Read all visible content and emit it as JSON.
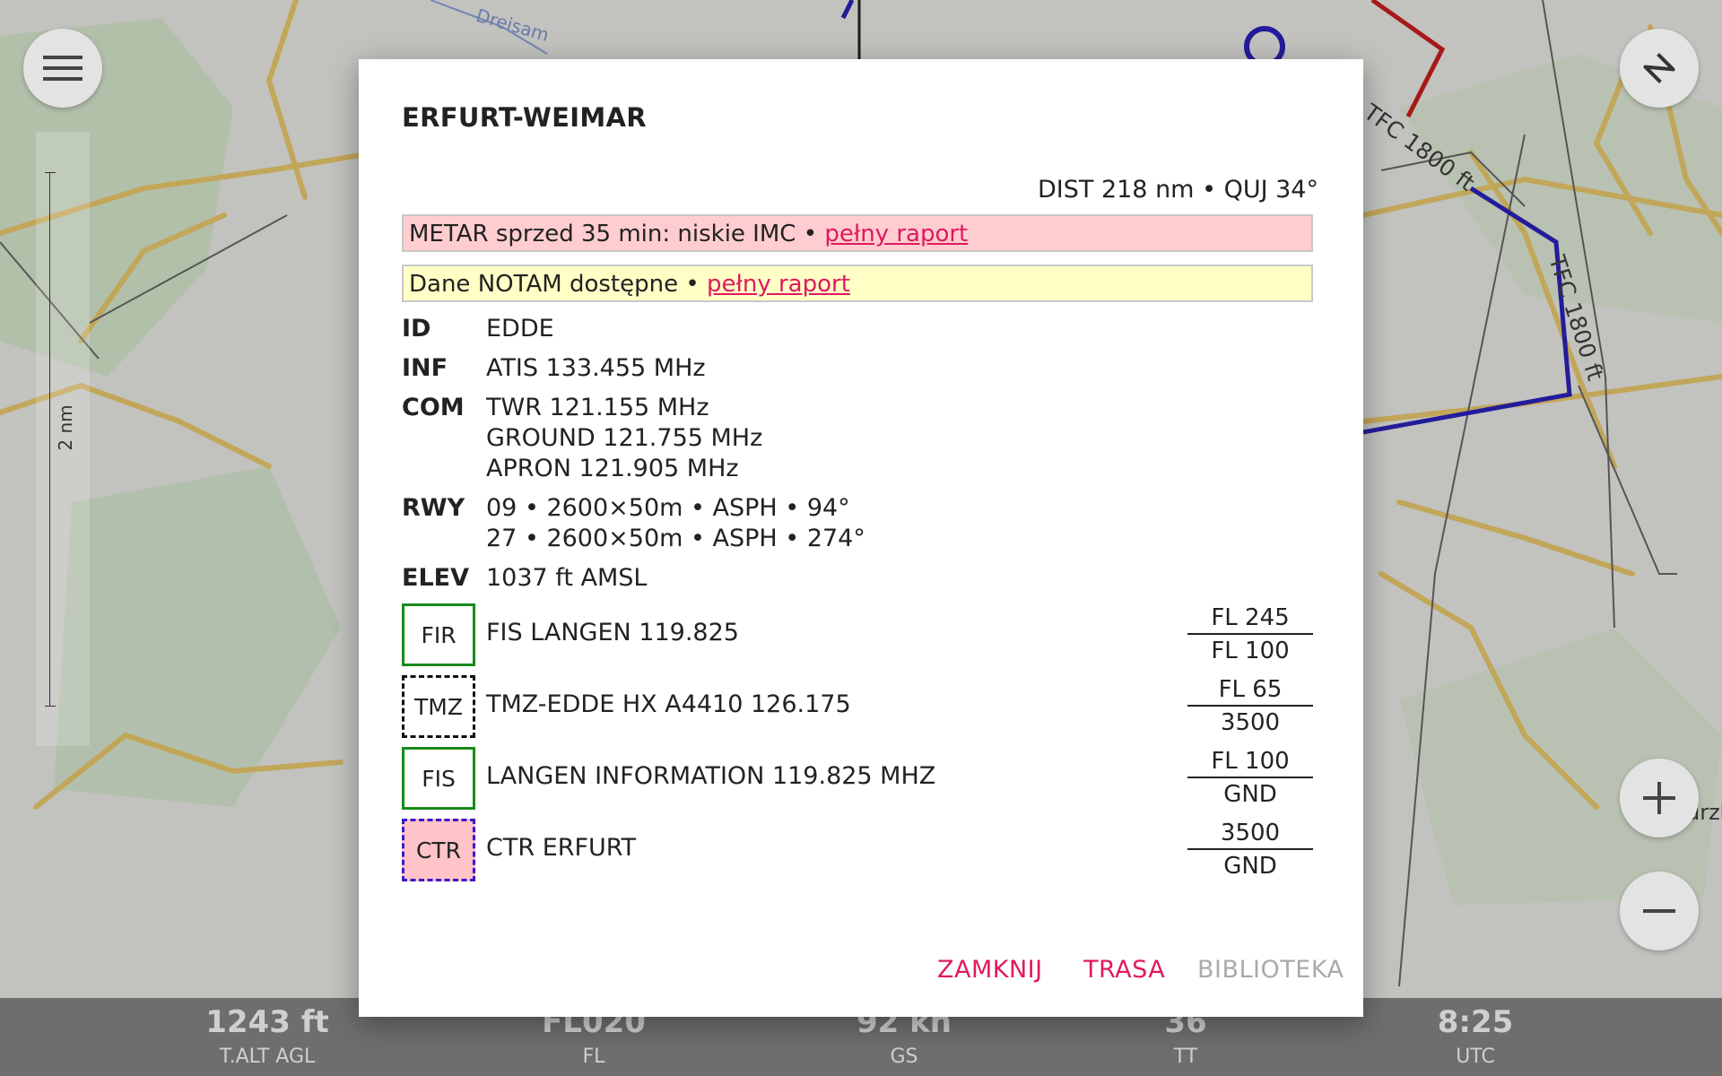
{
  "map": {
    "scale_label": "2 nm",
    "river_label": "Dreisam",
    "place_label_partial": "urzh",
    "traffic_labels": [
      "TFC 1800 ft",
      "TFC 1800 ft"
    ]
  },
  "controls": {
    "menu_icon": "hamburger-menu-icon",
    "north_icon": "compass-north-icon",
    "zoom_in_label": "+",
    "zoom_out_label": "−"
  },
  "dialog": {
    "title": "ERFURT-WEIMAR",
    "dist_info": "DIST 218 nm • QUJ 34°",
    "metar": {
      "text": "METAR sprzed 35 min: niskie IMC • ",
      "link": "pełny raport",
      "color": "#ffcdd0"
    },
    "notam": {
      "text": "Dane NOTAM dostępne • ",
      "link": "pełny raport",
      "color": "#ffffc6"
    },
    "info": {
      "id": {
        "key": "ID",
        "values": [
          "EDDE"
        ]
      },
      "inf": {
        "key": "INF",
        "values": [
          "ATIS 133.455 MHz"
        ]
      },
      "com": {
        "key": "COM",
        "values": [
          "TWR 121.155 MHz",
          "GROUND 121.755 MHz",
          "APRON 121.905 MHz"
        ]
      },
      "rwy": {
        "key": "RWY",
        "values": [
          "09 • 2600×50m • ASPH • 94°",
          "27 • 2600×50m • ASPH • 274°"
        ]
      },
      "elev": {
        "key": "ELEV",
        "values": [
          "1037 ft AMSL"
        ]
      }
    },
    "airspaces": [
      {
        "badge": "FIR",
        "name": "FIS LANGEN 119.825",
        "upper": "FL 245",
        "lower": "FL 100"
      },
      {
        "badge": "TMZ",
        "name": "TMZ-EDDE HX A4410 126.175",
        "upper": "FL 65",
        "lower": "3500"
      },
      {
        "badge": "FIS",
        "name": "LANGEN INFORMATION 119.825 MHZ",
        "upper": "FL 100",
        "lower": "GND"
      },
      {
        "badge": "CTR",
        "name": "CTR ERFURT",
        "upper": "3500",
        "lower": "GND"
      }
    ],
    "buttons": {
      "close": "ZAMKNIJ",
      "route": "TRASA",
      "library": "BIBLIOTEKA"
    },
    "accent_color": "#e0195f"
  },
  "status_bar": [
    {
      "value": "1243 ft",
      "label": "T.ALT AGL"
    },
    {
      "value": "FL020",
      "label": "FL"
    },
    {
      "value": "92 kn",
      "label": "GS"
    },
    {
      "value": "36",
      "label": "TT"
    },
    {
      "value": "8:25",
      "label": "UTC"
    }
  ]
}
